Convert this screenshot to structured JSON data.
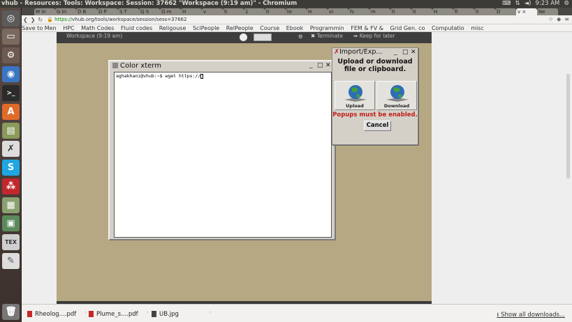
{
  "window": {
    "title": "vhub - Resources: Tools: Workspace: Session: 37662 \"Workspace (9:19 am)\" - Chromium",
    "tray_time": "9:23 AM"
  },
  "browser": {
    "url_secure": "https://",
    "url_host": "vhub.org",
    "url_path": "/tools/workspace/session/sess=37662",
    "bookmarks": [
      "Save to Men",
      "HPC",
      "Math Codes",
      "Fluid codes",
      "Religouse",
      "SciPeople",
      "RelPeople",
      "Course",
      "Ebook",
      "Programmin",
      "FEM & FV &",
      "Grid Gen. co",
      "Computatio",
      "misc"
    ]
  },
  "workspace": {
    "label": "Workspace (9:19 am)",
    "terminate_label": "Terminate",
    "keep_label": "Keep for later"
  },
  "xterm": {
    "title": "Color xterm",
    "prompt_line": "aghakhani@vhub:~$ wget https://"
  },
  "import_dialog": {
    "title": "Import/Exp...",
    "heading": "Upload or download file or clipboard.",
    "upload_label": "Upload",
    "download_label": "Download",
    "warning": "Popups must be enabled.",
    "cancel_label": "Cancel"
  },
  "downloads": {
    "items": [
      "Rheolog....pdf",
      "Plume_s....pdf",
      "UB.jpg"
    ],
    "show_all": "Show all downloads..."
  },
  "colors": {
    "desktop": "#b6a883",
    "launcher": "#4a3c37",
    "warning": "#c0201a"
  }
}
